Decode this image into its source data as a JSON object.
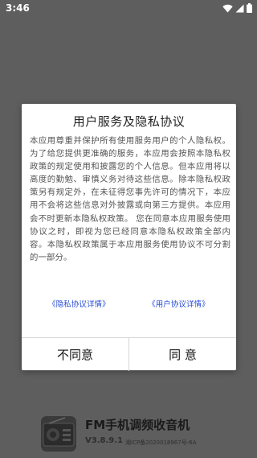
{
  "status_bar": {
    "time": "3:46"
  },
  "dialog": {
    "title": "用户服务及隐私协议",
    "body": "本应用尊重并保护所有使用服务用户的个人隐私权。为了给您提供更准确的服务，本应用会按照本隐私权政策的规定使用和披露您的个人信息。但本应用将以高度的勤勉、审慎义务对待这些信息。除本隐私权政策另有规定外，在未征得您事先许可的情况下，本应用不会将这些信息对外披露或向第三方提供。本应用会不时更新本隐私权政策。 您在同意本应用服务使用协议之时，即视为您已经同意本隐私权政策全部内容。本隐私权政策属于本应用服务使用协议不可分割的一部分。",
    "privacy_link": "《隐私协议详情》",
    "user_link": "《用户协议详情》",
    "disagree_label": "不同意",
    "agree_label": "同 意"
  },
  "footer": {
    "app_name": "FM手机调频收音机",
    "version": "V3.8.9.1",
    "icp": "湘ICP备2020018967号-6A"
  },
  "colors": {
    "overlay": "#5e5e5e",
    "link": "#2a4fd4"
  }
}
